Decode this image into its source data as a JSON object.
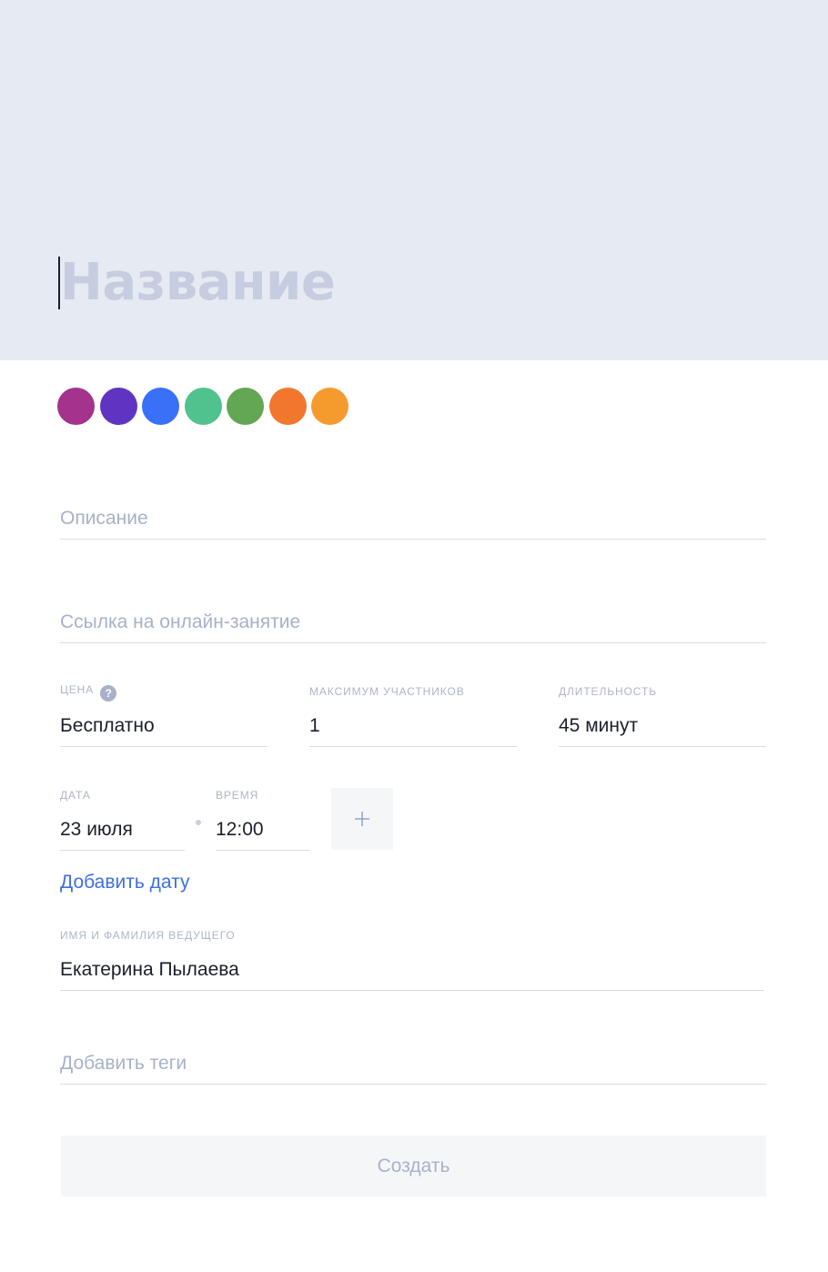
{
  "header": {
    "title_placeholder": "Название"
  },
  "colors": [
    {
      "name": "magenta",
      "hex": "#a3338d"
    },
    {
      "name": "violet",
      "hex": "#6034c3"
    },
    {
      "name": "blue",
      "hex": "#3a6ff7"
    },
    {
      "name": "teal",
      "hex": "#4fc28e"
    },
    {
      "name": "green",
      "hex": "#63a653"
    },
    {
      "name": "orange",
      "hex": "#f2772e"
    },
    {
      "name": "amber",
      "hex": "#f59b2e"
    }
  ],
  "fields": {
    "description_placeholder": "Описание",
    "online_link_placeholder": "Ссылка на онлайн-занятие",
    "price": {
      "label": "ЦЕНА",
      "help_icon": "question-icon",
      "help_glyph": "?",
      "value": "Бесплатно"
    },
    "max_participants": {
      "label": "МАКСИМУМ УЧАСТНИКОВ",
      "value": "1"
    },
    "duration": {
      "label": "ДЛИТЕЛЬНОСТЬ",
      "value": "45 минут"
    },
    "date": {
      "label": "ДАТА",
      "value": "23 июля"
    },
    "time": {
      "label": "ВРЕМЯ",
      "value": "12:00"
    },
    "add_date_link": "Добавить дату",
    "host": {
      "label": "ИМЯ И ФАМИЛИЯ ВЕДУЩЕГО",
      "value": "Екатерина Пылаева"
    },
    "tags_placeholder": "Добавить теги"
  },
  "actions": {
    "create_label": "Создать",
    "add_time_icon": "plus-icon"
  },
  "theme": {
    "header_bg": "#e6eaf2",
    "link_color": "#3d6fe0",
    "placeholder_color": "#a9b1ca"
  }
}
